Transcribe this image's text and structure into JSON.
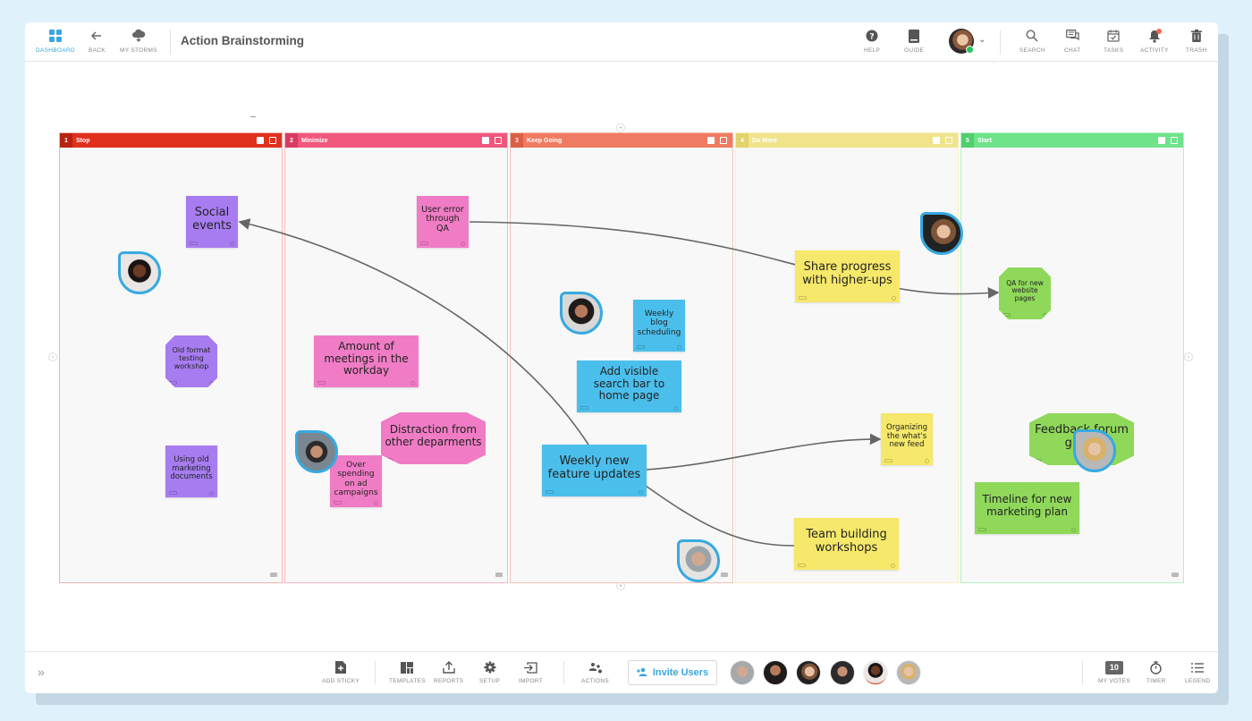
{
  "topbar": {
    "title": "Action Brainstorming",
    "left_buttons": [
      {
        "id": "dashboard",
        "label": "DASHBOARD",
        "icon": "dashboard-grid-icon"
      },
      {
        "id": "back",
        "label": "BACK",
        "icon": "arrow-left-icon"
      },
      {
        "id": "my-storms",
        "label": "MY STORMS",
        "icon": "cloud-icon"
      }
    ],
    "right_buttons": [
      {
        "id": "help",
        "label": "HELP",
        "icon": "help-circle-icon"
      },
      {
        "id": "guide",
        "label": "GUIDE",
        "icon": "book-icon"
      },
      {
        "id": "search",
        "label": "SEARCH",
        "icon": "search-icon"
      },
      {
        "id": "chat",
        "label": "CHAT",
        "icon": "chat-icon"
      },
      {
        "id": "tasks",
        "label": "TASKS",
        "icon": "calendar-check-icon"
      },
      {
        "id": "activity",
        "label": "ACTIVITY",
        "icon": "bell-icon"
      },
      {
        "id": "trash",
        "label": "TRASH",
        "icon": "trash-icon"
      }
    ],
    "user_status": "online"
  },
  "zoom": {
    "minus": "−",
    "plus": "+",
    "level_fraction": 0.1
  },
  "columns": [
    {
      "num": "1",
      "title": "Stop",
      "color": "#e0301e",
      "num_color": "#b82210",
      "border": "#f3b3aa"
    },
    {
      "num": "2",
      "title": "Minimize",
      "color": "#f0577c",
      "num_color": "#d83a62",
      "border": "#f7b5c5"
    },
    {
      "num": "3",
      "title": "Keep Going",
      "color": "#ef7b62",
      "num_color": "#dd5e43",
      "border": "#f5c0b2"
    },
    {
      "num": "4",
      "title": "Do More",
      "color": "#efe48c",
      "num_color": "#e2d36b",
      "border": "#f5efc0"
    },
    {
      "num": "5",
      "title": "Start",
      "color": "#6ee38a",
      "num_color": "#4fcf6d",
      "border": "#b8f0c6"
    }
  ],
  "stickies": [
    {
      "id": "s1",
      "text": "Social events",
      "color": "#a77cf0",
      "column": 1,
      "shape": "square"
    },
    {
      "id": "s2",
      "text": "Old format testing workshop",
      "color": "#a77cf0",
      "column": 1,
      "shape": "octagon"
    },
    {
      "id": "s3",
      "text": "Using old marketing documents",
      "color": "#a77cf0",
      "column": 1,
      "shape": "square"
    },
    {
      "id": "s4",
      "text": "User error through QA",
      "color": "#f07cc5",
      "column": 2,
      "shape": "square"
    },
    {
      "id": "s5",
      "text": "Amount of meetings in the workday",
      "color": "#f07cc5",
      "column": 2,
      "shape": "square"
    },
    {
      "id": "s6",
      "text": "Distraction from other deparments",
      "color": "#f07cc5",
      "column": 2,
      "shape": "octagon"
    },
    {
      "id": "s7",
      "text": "Over spending on ad campaigns",
      "color": "#f07cc5",
      "column": 2,
      "shape": "square"
    },
    {
      "id": "s8",
      "text": "Weekly blog scheduling",
      "color": "#4bbfec",
      "column": 3,
      "shape": "square"
    },
    {
      "id": "s9",
      "text": "Add visible search bar to home page",
      "color": "#4bbfec",
      "column": 3,
      "shape": "square"
    },
    {
      "id": "s10",
      "text": "Weekly new feature updates",
      "color": "#4bbfec",
      "column": 3,
      "shape": "square"
    },
    {
      "id": "s11",
      "text": "Share progress with higher-ups",
      "color": "#f6e86a",
      "column": 4,
      "shape": "square"
    },
    {
      "id": "s12",
      "text": "Organizing the what's new feed",
      "color": "#f6e86a",
      "column": 4,
      "shape": "square"
    },
    {
      "id": "s13",
      "text": "Team building workshops",
      "color": "#f6e86a",
      "column": 4,
      "shape": "square"
    },
    {
      "id": "s14",
      "text": "QA for new website pages",
      "color": "#8fd85a",
      "column": 5,
      "shape": "octagon"
    },
    {
      "id": "s15",
      "text": "Feedback forum group",
      "color": "#8fd85a",
      "column": 5,
      "shape": "octagon"
    },
    {
      "id": "s16",
      "text": "Timeline for new marketing plan",
      "color": "#8fd85a",
      "column": 5,
      "shape": "square"
    }
  ],
  "links": [
    {
      "from": "s10",
      "to": "s1"
    },
    {
      "from": "s4",
      "to": "s14"
    },
    {
      "from": "s10",
      "to": "s12"
    },
    {
      "from": "s10",
      "to": "s13"
    }
  ],
  "bottombar": {
    "expand_icon": "»",
    "buttons": [
      {
        "id": "add-sticky",
        "label": "ADD STICKY",
        "icon": "add-sticky-icon"
      },
      {
        "id": "templates",
        "label": "TEMPLATES",
        "icon": "templates-icon"
      },
      {
        "id": "reports",
        "label": "REPORTS",
        "icon": "upload-icon"
      },
      {
        "id": "setup",
        "label": "SETUP",
        "icon": "gear-icon"
      },
      {
        "id": "import",
        "label": "IMPORT",
        "icon": "import-icon"
      },
      {
        "id": "actions",
        "label": "ACTIONS",
        "icon": "actions-people-icon"
      }
    ],
    "invite_label": "Invite Users",
    "participants": [
      "user-1",
      "user-2",
      "user-3",
      "user-4",
      "user-5",
      "user-6"
    ],
    "my_votes_count": "10",
    "my_votes_label": "MY VOTES",
    "timer_label": "TIMER",
    "legend_label": "LEGEND"
  }
}
